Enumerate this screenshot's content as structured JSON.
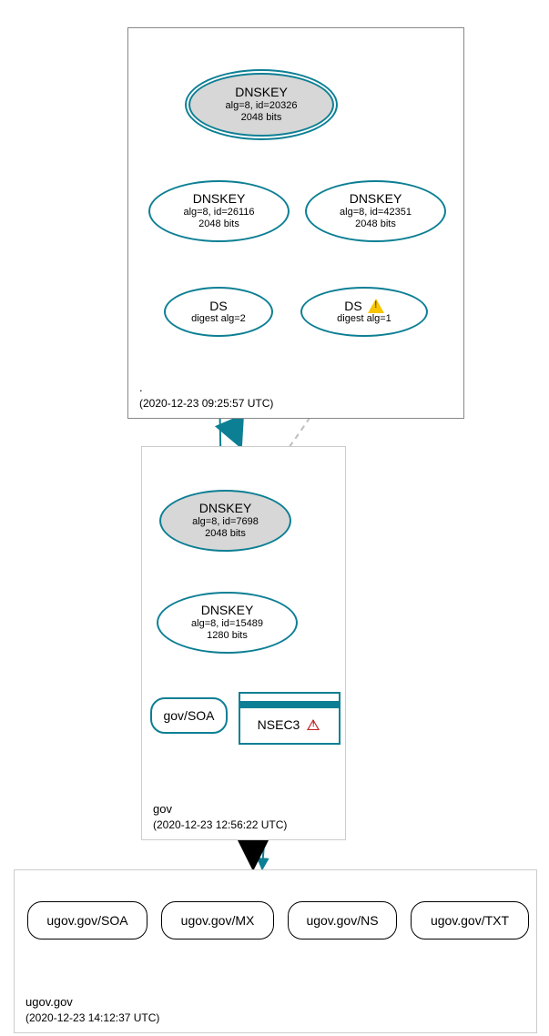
{
  "zones": {
    "root": {
      "name": ".",
      "timestamp": "(2020-12-23 09:25:57 UTC)"
    },
    "gov": {
      "name": "gov",
      "timestamp": "(2020-12-23 12:56:22 UTC)"
    },
    "ugov": {
      "name": "ugov.gov",
      "timestamp": "(2020-12-23 14:12:37 UTC)"
    }
  },
  "nodes": {
    "root_ksk": {
      "title": "DNSKEY",
      "line1": "alg=8, id=20326",
      "line2": "2048 bits"
    },
    "root_zsk1": {
      "title": "DNSKEY",
      "line1": "alg=8, id=26116",
      "line2": "2048 bits"
    },
    "root_zsk2": {
      "title": "DNSKEY",
      "line1": "alg=8, id=42351",
      "line2": "2048 bits"
    },
    "ds1": {
      "title": "DS",
      "line1": "digest alg=2"
    },
    "ds2": {
      "title": "DS",
      "line1": "digest alg=1"
    },
    "gov_ksk": {
      "title": "DNSKEY",
      "line1": "alg=8, id=7698",
      "line2": "2048 bits"
    },
    "gov_zsk": {
      "title": "DNSKEY",
      "line1": "alg=8, id=15489",
      "line2": "1280 bits"
    },
    "gov_soa": {
      "label": "gov/SOA"
    },
    "nsec3": {
      "label": "NSEC3"
    },
    "ugov_soa": {
      "label": "ugov.gov/SOA"
    },
    "ugov_mx": {
      "label": "ugov.gov/MX"
    },
    "ugov_ns": {
      "label": "ugov.gov/NS"
    },
    "ugov_txt": {
      "label": "ugov.gov/TXT"
    }
  },
  "icons": {
    "ds2_warn": "warning-yellow",
    "nsec3_warn": "warning-red"
  },
  "edges": [
    {
      "from": "root_ksk",
      "to": "root_ksk",
      "style": "self-teal"
    },
    {
      "from": "root_ksk",
      "to": "root_zsk1",
      "style": "teal"
    },
    {
      "from": "root_ksk",
      "to": "root_zsk2",
      "style": "teal"
    },
    {
      "from": "root_zsk1",
      "to": "ds1",
      "style": "teal"
    },
    {
      "from": "root_zsk1",
      "to": "ds2",
      "style": "teal"
    },
    {
      "from": "ds1",
      "to": "gov_ksk",
      "style": "teal"
    },
    {
      "from": "ds2",
      "to": "gov_ksk",
      "style": "gray-dashed"
    },
    {
      "from": "gov_ksk",
      "to": "gov_ksk",
      "style": "self-teal"
    },
    {
      "from": "gov_ksk",
      "to": "gov_zsk",
      "style": "teal"
    },
    {
      "from": "gov_zsk",
      "to": "gov_soa",
      "style": "teal"
    },
    {
      "from": "gov_zsk",
      "to": "nsec3",
      "style": "teal"
    },
    {
      "from": "zone_root",
      "to": "zone_gov",
      "style": "thick-teal"
    },
    {
      "from": "zone_gov",
      "to": "zone_ugov",
      "style": "thick-black"
    },
    {
      "from": "nsec3",
      "to": "zone_ugov",
      "style": "teal"
    }
  ],
  "colors": {
    "teal": "#0d7f94",
    "gray": "#bfbfbf",
    "fill_ksk": "#d7d7d7"
  }
}
